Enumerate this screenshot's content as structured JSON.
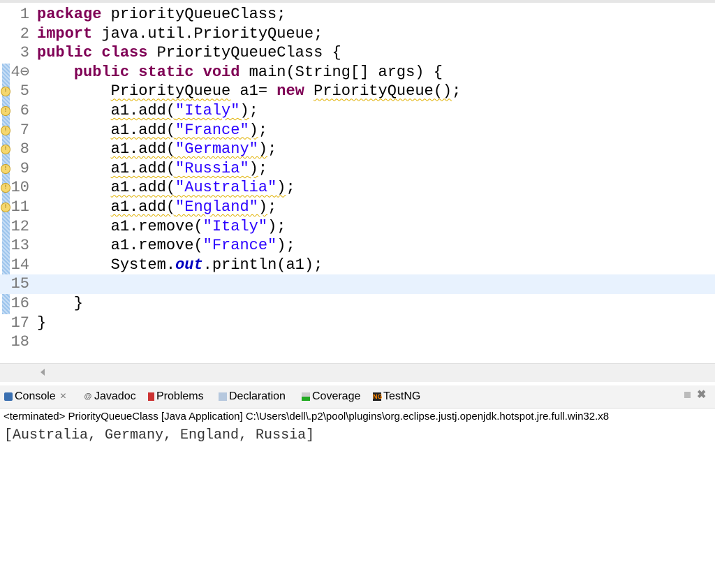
{
  "editor": {
    "current_line": 15,
    "lines": [
      {
        "n": "1",
        "t": [
          [
            "package",
            "kw"
          ],
          [
            " priorityQueueClass;",
            ""
          ]
        ]
      },
      {
        "n": "2",
        "t": [
          [
            "import",
            "kw"
          ],
          [
            " java.util.PriorityQueue;",
            ""
          ]
        ]
      },
      {
        "n": "3",
        "t": [
          [
            "public",
            "kw"
          ],
          [
            " ",
            ""
          ],
          [
            "class",
            "kw"
          ],
          [
            " PriorityQueueClass {",
            ""
          ]
        ]
      },
      {
        "n": "4⊖",
        "t": [
          [
            "    ",
            ""
          ],
          [
            "public",
            "kw"
          ],
          [
            " ",
            ""
          ],
          [
            "static",
            "kw"
          ],
          [
            " ",
            ""
          ],
          [
            "void",
            "kw"
          ],
          [
            " main(String[] args) {",
            ""
          ]
        ]
      },
      {
        "n": "5",
        "w": true,
        "t": [
          [
            "        ",
            ""
          ],
          [
            "PriorityQueue",
            "warn"
          ],
          [
            " a1= ",
            ""
          ],
          [
            "new",
            "kw"
          ],
          [
            " ",
            ""
          ],
          [
            "PriorityQueue()",
            "warn"
          ],
          [
            ";",
            ""
          ]
        ]
      },
      {
        "n": "6",
        "w": true,
        "t": [
          [
            "        ",
            ""
          ],
          [
            "a1.add(",
            "warn"
          ],
          [
            "\"Italy\"",
            "str warn"
          ],
          [
            ")",
            "warn"
          ],
          [
            ";",
            ""
          ]
        ]
      },
      {
        "n": "7",
        "w": true,
        "t": [
          [
            "        ",
            ""
          ],
          [
            "a1.add(",
            "warn"
          ],
          [
            "\"France\"",
            "str warn"
          ],
          [
            ")",
            "warn"
          ],
          [
            ";",
            ""
          ]
        ]
      },
      {
        "n": "8",
        "w": true,
        "t": [
          [
            "        ",
            ""
          ],
          [
            "a1.add(",
            "warn"
          ],
          [
            "\"Germany\"",
            "str warn"
          ],
          [
            ")",
            "warn"
          ],
          [
            ";",
            ""
          ]
        ]
      },
      {
        "n": "9",
        "w": true,
        "t": [
          [
            "        ",
            ""
          ],
          [
            "a1.add(",
            "warn"
          ],
          [
            "\"Russia\"",
            "str warn"
          ],
          [
            ")",
            "warn"
          ],
          [
            ";",
            ""
          ]
        ]
      },
      {
        "n": "10",
        "w": true,
        "t": [
          [
            "        ",
            ""
          ],
          [
            "a1.add(",
            "warn"
          ],
          [
            "\"Australia\"",
            "str warn"
          ],
          [
            ")",
            "warn"
          ],
          [
            ";",
            ""
          ]
        ]
      },
      {
        "n": "11",
        "w": true,
        "t": [
          [
            "        ",
            ""
          ],
          [
            "a1.add(",
            "warn"
          ],
          [
            "\"England\"",
            "str warn"
          ],
          [
            ")",
            "warn"
          ],
          [
            ";",
            ""
          ]
        ]
      },
      {
        "n": "12",
        "t": [
          [
            "        a1.remove(",
            ""
          ],
          [
            "\"Italy\"",
            "str"
          ],
          [
            ");",
            ""
          ]
        ]
      },
      {
        "n": "13",
        "t": [
          [
            "        a1.remove(",
            ""
          ],
          [
            "\"France\"",
            "str"
          ],
          [
            ");",
            ""
          ]
        ]
      },
      {
        "n": "14",
        "t": [
          [
            "        System.",
            ""
          ],
          [
            "out",
            "fld"
          ],
          [
            ".println(a1);",
            ""
          ]
        ]
      },
      {
        "n": "15",
        "t": []
      },
      {
        "n": "16",
        "t": [
          [
            "    }",
            ""
          ]
        ]
      },
      {
        "n": "17",
        "t": [
          [
            "}",
            ""
          ]
        ]
      },
      {
        "n": "18",
        "t": []
      }
    ]
  },
  "console": {
    "tabs": [
      {
        "label": "Console",
        "icon": "console-icon",
        "close": "×"
      },
      {
        "label": "Javadoc",
        "icon": "javadoc-icon"
      },
      {
        "label": "Problems",
        "icon": "problems-icon"
      },
      {
        "label": "Declaration",
        "icon": "declaration-icon"
      },
      {
        "label": "Coverage",
        "icon": "coverage-icon"
      },
      {
        "label": "TestNG",
        "icon": "testng-icon"
      }
    ],
    "status": "<terminated> PriorityQueueClass [Java Application] C:\\Users\\dell\\.p2\\pool\\plugins\\org.eclipse.justj.openjdk.hotspot.jre.full.win32.x8",
    "output": "[Australia, Germany, England, Russia]"
  }
}
